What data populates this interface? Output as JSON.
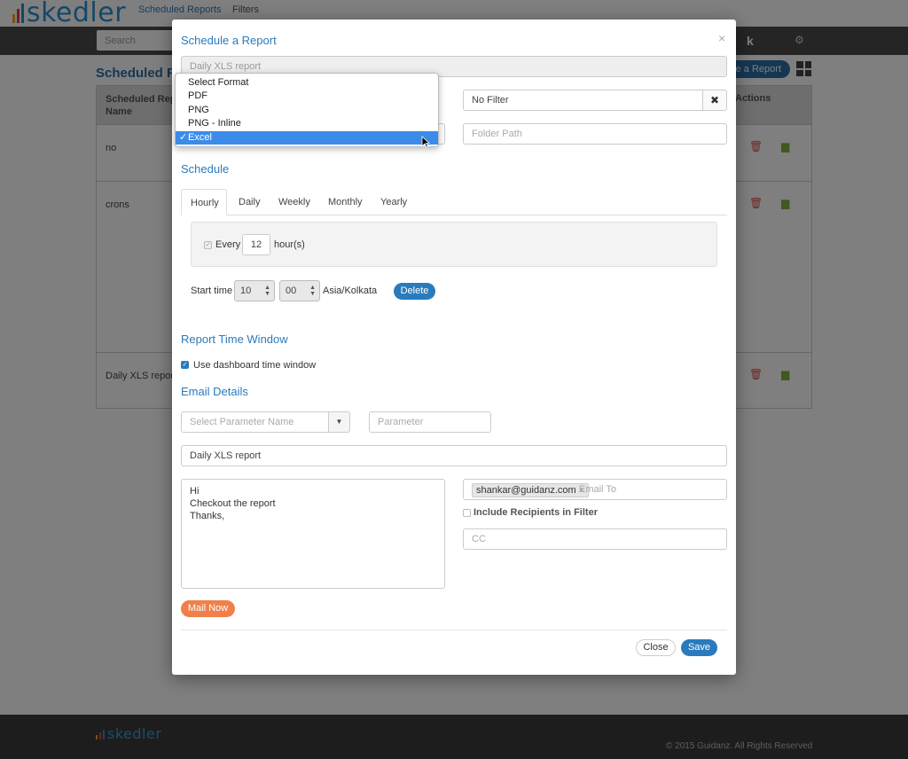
{
  "app": {
    "logo_text": "skedler",
    "logo_colors": [
      "#f0a030",
      "#e04040",
      "#2a8fd0"
    ],
    "nav": [
      "Scheduled Reports",
      "Filters"
    ],
    "search_placeholder": "Search",
    "toolbar_badge": "k",
    "page_title": "Scheduled Rep",
    "schedule_button": "le a Report",
    "table": {
      "header_name": "Scheduled Report Name",
      "header_name_line1": "Scheduled Repo",
      "header_name_line2": "Name",
      "header_actions": "Actions",
      "rows": [
        {
          "name": "no"
        },
        {
          "name": "crons"
        },
        {
          "name": "Daily XLS report"
        }
      ]
    },
    "footer_logo": "skedler",
    "footer_copyright": "© 2015 Guidanz. All Rights Reserved"
  },
  "modal": {
    "title": "Schedule a Report",
    "close_glyph": "×",
    "report_name": "Daily XLS report",
    "filter_value": "No Filter",
    "filter_clear_glyph": "✖",
    "folder_placeholder": "Folder Path",
    "schedule_title": "Schedule",
    "tabs": [
      "Hourly",
      "Daily",
      "Weekly",
      "Monthly",
      "Yearly"
    ],
    "active_tab": "Hourly",
    "every_label": "Every",
    "every_value": "12",
    "hours_label": "hour(s)",
    "start_time_label": "Start time",
    "start_hour": "10",
    "start_minute": "00",
    "timezone": "Asia/Kolkata",
    "delete_button": "Delete",
    "report_time_window_title": "Report Time Window",
    "use_dashboard_label": "Use dashboard time window",
    "use_dashboard_checked": true,
    "email_title": "Email Details",
    "param_name_placeholder": "Select Parameter Name",
    "param_placeholder": "Parameter",
    "email_subject": "Daily XLS report",
    "email_body": [
      "Hi",
      "Checkout the report",
      "Thanks,"
    ],
    "email_to_tag": "shankar@guidanz.com",
    "email_to_placeholder": "Email To",
    "include_recipients_label": "Include Recipients in Filter",
    "cc_placeholder": "CC",
    "mail_now_button": "Mail Now",
    "close_button": "Close",
    "save_button": "Save"
  },
  "format_dropdown": {
    "options": [
      "Select Format",
      "PDF",
      "PNG",
      "PNG - Inline",
      "Excel"
    ],
    "selected": "Excel",
    "check_glyph": "✓"
  },
  "colors": {
    "accent": "#2a7bbd",
    "mail_now": "#f0804a",
    "dropdown_highlight": "#3b8ce8",
    "delete_icon": "#d9534f",
    "doc_icon": "#7cb342"
  }
}
